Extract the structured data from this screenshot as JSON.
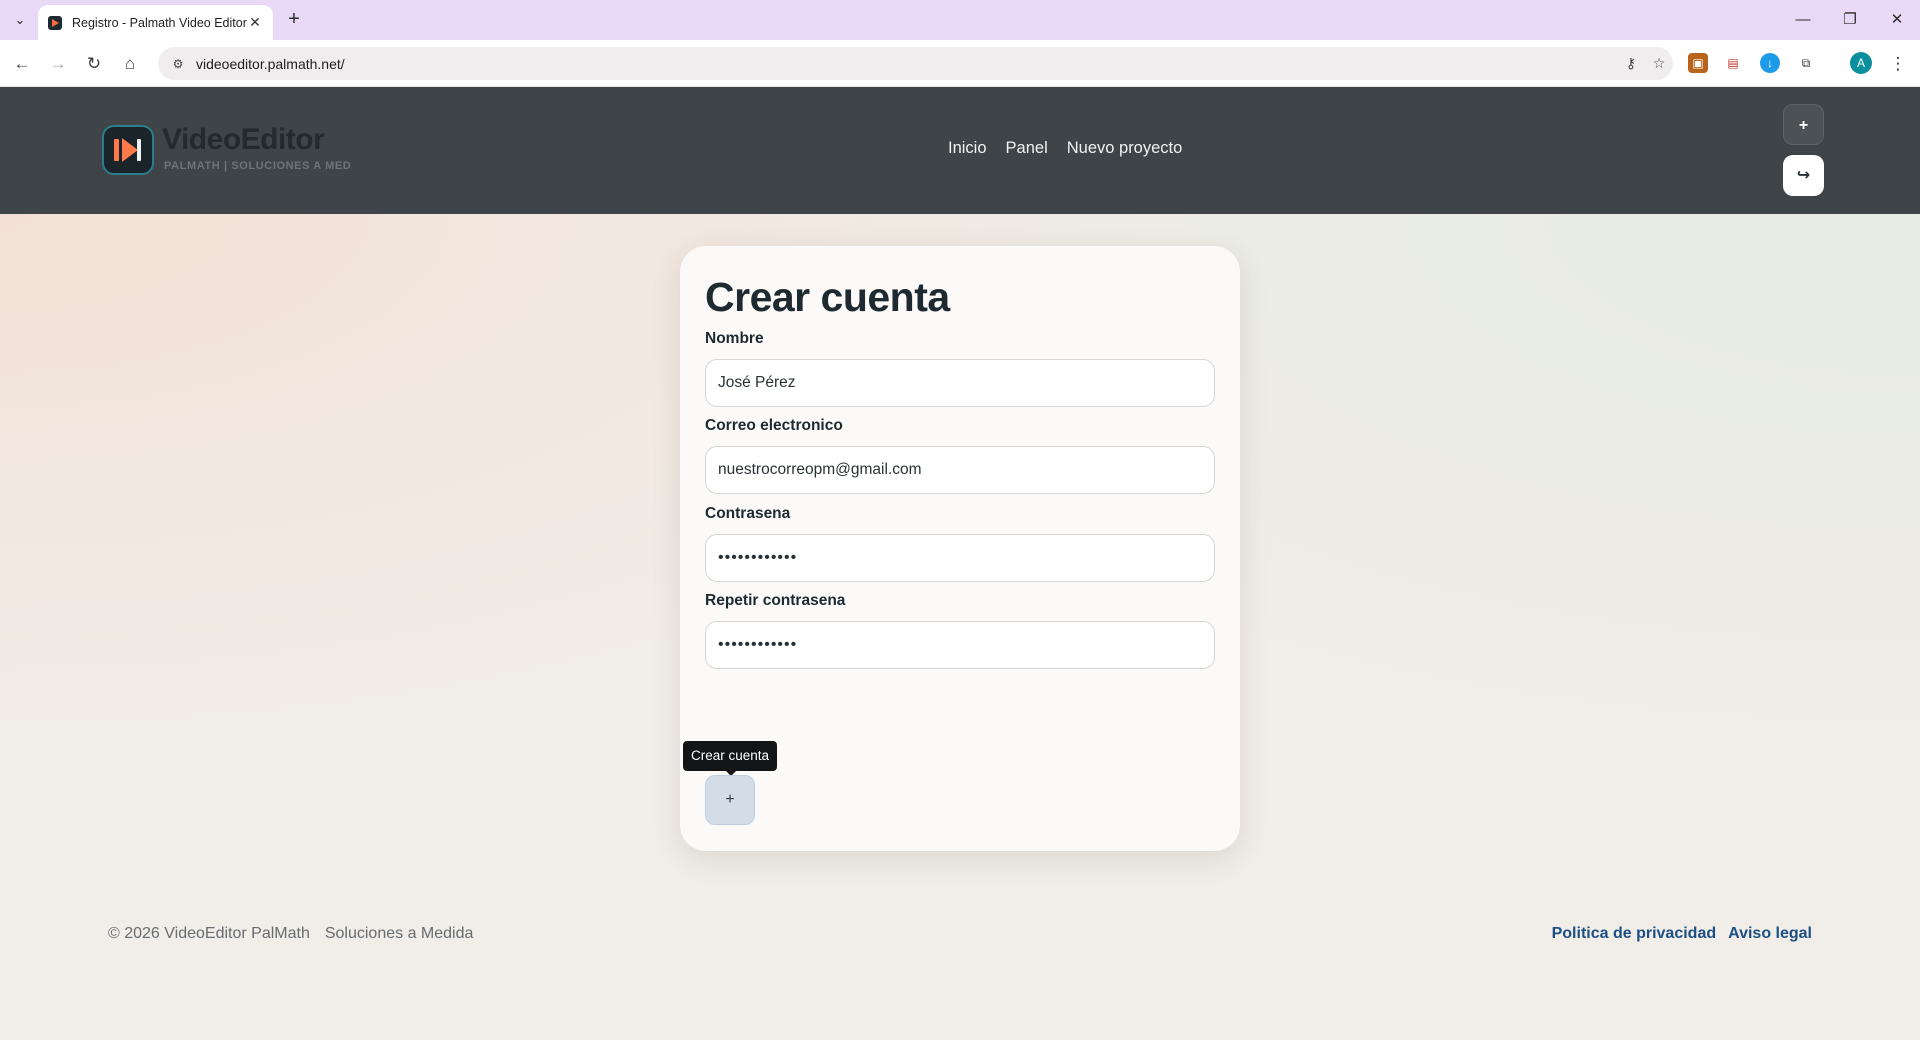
{
  "browser": {
    "tab_title": "Registro - Palmath Video Editor",
    "tab_close": "✕",
    "new_tab": "+",
    "url": "videoeditor.palmath.net/",
    "profile_initial": "A"
  },
  "header": {
    "brand_name": "VideoEditor",
    "brand_tagline": "PALMATH | SOLUCIONES A MED",
    "nav": [
      "Inicio",
      "Panel",
      "Nuevo proyecto"
    ],
    "add_button": "+",
    "logout_button": "↪"
  },
  "form": {
    "title": "Crear cuenta",
    "fields": [
      {
        "label": "Nombre",
        "value": "José Pérez"
      },
      {
        "label": "Correo electronico",
        "value": "nuestrocorreopm@gmail.com"
      },
      {
        "label": "Contrasena",
        "value": "••••••••••••"
      },
      {
        "label": "Repetir contrasena",
        "value": "••••••••••••"
      }
    ],
    "submit_tooltip": "Crear cuenta",
    "submit_icon": "+"
  },
  "footer": {
    "copyright": "© 2026 VideoEditor PalMath",
    "tagline": "Soluciones a Medida",
    "links": [
      "Politica de privacidad",
      "Aviso legal"
    ]
  },
  "colors": {
    "header_bg": "#3f4448",
    "accent": "#ff7a4a",
    "link": "#1c4f84",
    "tabbar": "#e9d8f6"
  }
}
